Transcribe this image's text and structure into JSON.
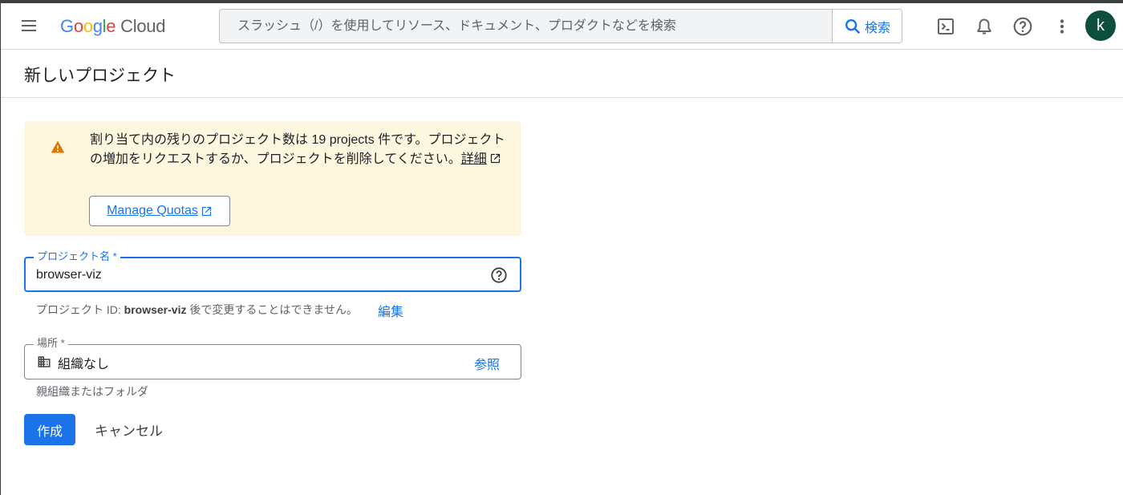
{
  "header": {
    "logo": {
      "letters": [
        "G",
        "o",
        "o",
        "g",
        "l",
        "e"
      ],
      "product": "Cloud"
    },
    "search": {
      "placeholder": "スラッシュ（/）を使用してリソース、ドキュメント、プロダクトなどを検索",
      "button_label": "検索"
    },
    "icons": [
      "menu-icon",
      "terminal-icon",
      "bell-icon",
      "help-icon",
      "more-vert-icon"
    ],
    "avatar_initial": "k",
    "avatar_color": "#0d4f3c"
  },
  "page": {
    "title": "新しいプロジェクト"
  },
  "warning": {
    "message": "割り当て内の残りのプロジェクト数は 19 projects 件です。プロジェクトの増加をリクエストするか、プロジェクトを削除してください。",
    "details_link": "詳細",
    "quota_button": "Manage Quotas",
    "background": "#fef7e0",
    "icon_color": "#e37400"
  },
  "form": {
    "project_name": {
      "label": "プロジェクト名 *",
      "value": "browser-viz"
    },
    "project_id_helper": {
      "prefix": "プロジェクト ID:",
      "id": "browser-viz",
      "suffix": "後で変更することはできません。",
      "edit_link": "編集"
    },
    "location": {
      "label": "場所 *",
      "value": "組織なし",
      "browse_link": "参照",
      "helper": "親組織またはフォルダ"
    }
  },
  "actions": {
    "create": "作成",
    "cancel": "キャンセル",
    "primary_color": "#1a73e8"
  }
}
